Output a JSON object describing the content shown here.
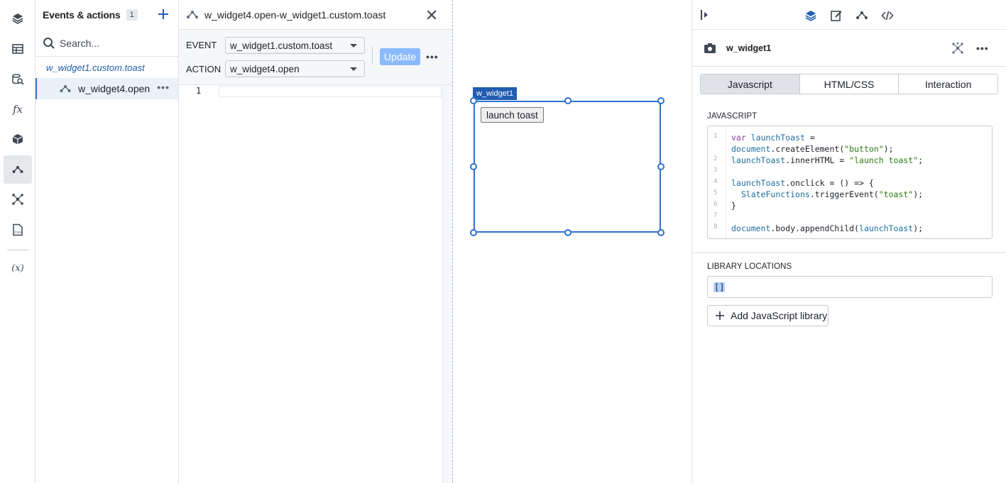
{
  "rail": {
    "icons": [
      "layers-icon",
      "table-icon",
      "query-icon",
      "function-icon",
      "box-icon",
      "events-icon",
      "sparkle-icon",
      "css-icon",
      "variable-icon"
    ],
    "function_glyph": "fx",
    "variable_glyph": "(x)"
  },
  "events_panel": {
    "title": "Events & actions",
    "count": "1",
    "search_placeholder": "Search...",
    "group_label": "w_widget1.custom.toast",
    "item_label": "w_widget4.open",
    "more_glyph": "•••"
  },
  "editor": {
    "title": "w_widget4.open-w_widget1.custom.toast",
    "event_label": "EVENT",
    "event_value": "w_widget1.custom.toast",
    "action_label": "ACTION",
    "action_value": "w_widget4.open",
    "update_label": "Update",
    "more_glyph": "•••",
    "line_number": "1"
  },
  "canvas": {
    "widget_tag": "w_widget1",
    "launch_button": "launch toast"
  },
  "props": {
    "widget_name": "w_widget1",
    "more_glyph": "•••",
    "tabs": [
      "Javascript",
      "HTML/CSS",
      "Interaction"
    ],
    "active_tab": "Javascript",
    "js_section_label": "JAVASCRIPT",
    "code_lines": [
      {
        "ln": "1",
        "text": "var launchToast ="
      },
      {
        "ln": "",
        "text": "document.createElement(\"button\");"
      },
      {
        "ln": "2",
        "text": "launchToast.innerHTML = \"launch toast\";"
      },
      {
        "ln": "3",
        "text": ""
      },
      {
        "ln": "4",
        "text": "launchToast.onclick = () => {"
      },
      {
        "ln": "5",
        "text": "  SlateFunctions.triggerEvent(\"toast\");"
      },
      {
        "ln": "6",
        "text": "}"
      },
      {
        "ln": "7",
        "text": ""
      },
      {
        "ln": "8",
        "text": "document.body.appendChild(launchToast);"
      }
    ],
    "library_label": "LIBRARY LOCATIONS",
    "library_value": "[]",
    "add_library_label": "Add JavaScript library"
  },
  "colors": {
    "accent": "#2d72d2",
    "update_disabled": "#8abbff",
    "widget_tag_bg": "#215db0"
  }
}
